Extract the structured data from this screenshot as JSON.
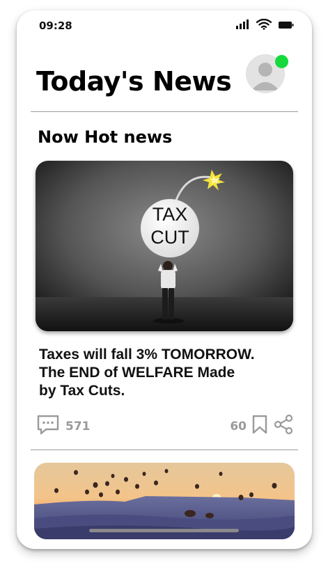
{
  "status_bar": {
    "time": "09:28",
    "icons": [
      "signal-icon",
      "wifi-icon",
      "battery-icon"
    ]
  },
  "header": {
    "title": "Today's News",
    "avatar_icon": "user-avatar-icon",
    "online_color": "#16d93c"
  },
  "section": {
    "title": "Now Hot news"
  },
  "featured": {
    "image_text_line1": "TAX",
    "image_text_line2": "CUT",
    "headline_line1": "Taxes will fall 3% TOMORROW.",
    "headline_line2": "The END of WELFARE Made",
    "headline_line3": "by Tax Cuts.",
    "comments": "571",
    "bookmarks": "60"
  },
  "colors": {
    "meta_gray": "#9a9a9a",
    "accent_online": "#16d93c"
  }
}
